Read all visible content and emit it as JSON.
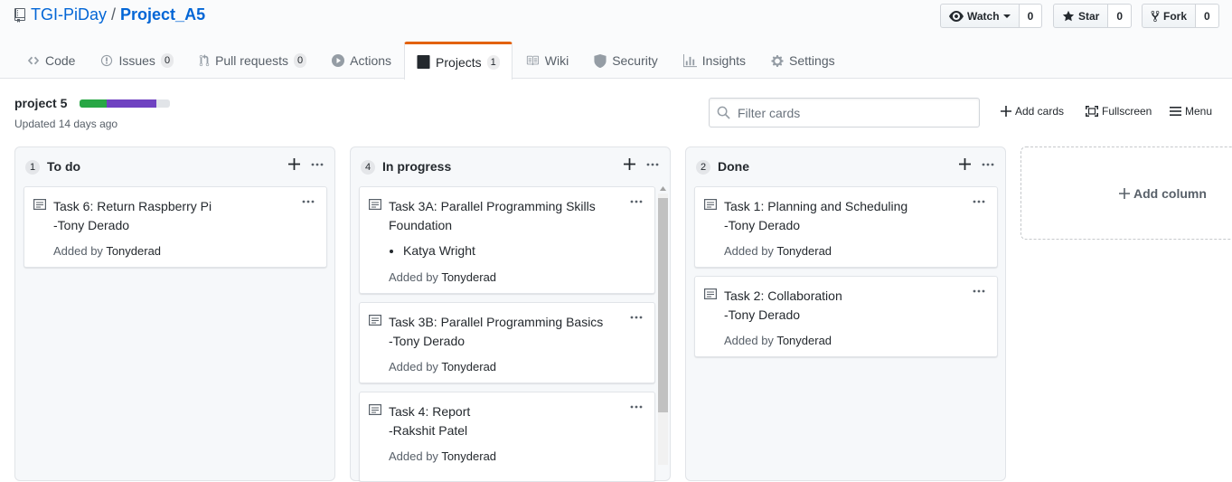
{
  "repo": {
    "owner": "TGI-PiDay",
    "separator": "/",
    "name": "Project_A5"
  },
  "actions": {
    "watch": {
      "label": "Watch",
      "count": "0"
    },
    "star": {
      "label": "Star",
      "count": "0"
    },
    "fork": {
      "label": "Fork",
      "count": "0"
    }
  },
  "tabs": [
    {
      "label": "Code",
      "icon": "code-icon"
    },
    {
      "label": "Issues",
      "count": "0",
      "icon": "issue-icon"
    },
    {
      "label": "Pull requests",
      "count": "0",
      "icon": "pull-request-icon"
    },
    {
      "label": "Actions",
      "icon": "play-icon"
    },
    {
      "label": "Projects",
      "count": "1",
      "icon": "project-icon",
      "selected": true
    },
    {
      "label": "Wiki",
      "icon": "book-icon"
    },
    {
      "label": "Security",
      "icon": "shield-icon"
    },
    {
      "label": "Insights",
      "icon": "graph-icon"
    },
    {
      "label": "Settings",
      "icon": "gear-icon"
    }
  ],
  "project": {
    "name": "project 5",
    "updated": "Updated 14 days ago",
    "progress": {
      "done": 0.3,
      "in_progress": 0.55,
      "colors": {
        "done": "#28a745",
        "in_progress": "#6f42c1",
        "todo": "#e1e4e8"
      }
    },
    "filter_placeholder": "Filter cards",
    "add_cards": "Add cards",
    "fullscreen": "Fullscreen",
    "menu": "Menu"
  },
  "columns": [
    {
      "count": "1",
      "title": "To do",
      "cards": [
        {
          "title": "Task 6: Return Raspberry Pi\n-Tony Derado",
          "added_prefix": "Added by",
          "added_by": "Tonyderad"
        }
      ]
    },
    {
      "count": "4",
      "title": "In progress",
      "cards": [
        {
          "title": "Task 3A: Parallel Programming Skills\nFoundation",
          "bullets": [
            "Katya Wright"
          ],
          "added_prefix": "Added by",
          "added_by": "Tonyderad"
        },
        {
          "title": "Task 3B: Parallel Programming Basics\n-Tony Derado",
          "added_prefix": "Added by",
          "added_by": "Tonyderad"
        },
        {
          "title": "Task 4: Report\n-Rakshit Patel",
          "added_prefix": "Added by",
          "added_by": "Tonyderad"
        }
      ]
    },
    {
      "count": "2",
      "title": "Done",
      "cards": [
        {
          "title": "Task 1: Planning and Scheduling\n-Tony Derado",
          "added_prefix": "Added by",
          "added_by": "Tonyderad"
        },
        {
          "title": "Task 2: Collaboration\n-Tony Derado",
          "added_prefix": "Added by",
          "added_by": "Tonyderad"
        }
      ]
    }
  ],
  "add_column": "Add column"
}
